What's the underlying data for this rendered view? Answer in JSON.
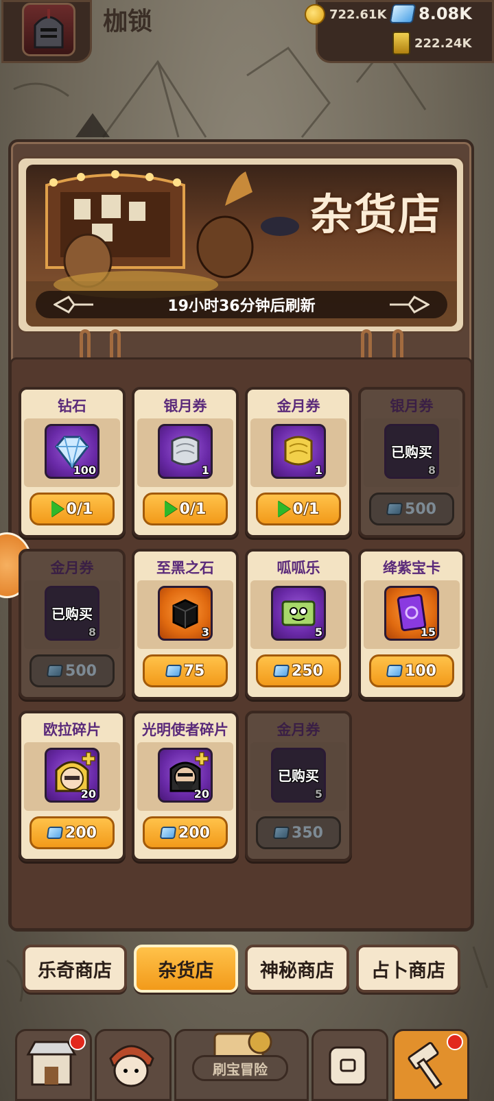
{
  "header": {
    "title": "枷锁",
    "gold": "722.61K",
    "diamonds": "8.08K",
    "potion": "222.24K"
  },
  "banner": {
    "title": "杂货店",
    "refresh": "19小时36分钟后刷新"
  },
  "items": [
    {
      "name": "钻石",
      "qty": "100",
      "price": "0/1",
      "type": "ad",
      "sold": false
    },
    {
      "name": "银月券",
      "qty": "1",
      "price": "0/1",
      "type": "ad",
      "sold": false
    },
    {
      "name": "金月券",
      "qty": "1",
      "price": "0/1",
      "type": "ad",
      "sold": false
    },
    {
      "name": "银月券",
      "qty": "8",
      "price": "500",
      "type": "gem",
      "sold": true,
      "sold_text": "已购买"
    },
    {
      "name": "金月券",
      "qty": "8",
      "price": "500",
      "type": "gem",
      "sold": true,
      "sold_text": "已购买"
    },
    {
      "name": "至黑之石",
      "qty": "3",
      "price": "75",
      "type": "gem",
      "sold": false
    },
    {
      "name": "呱呱乐",
      "qty": "5",
      "price": "250",
      "type": "gem",
      "sold": false
    },
    {
      "name": "绛紫宝卡",
      "qty": "15",
      "price": "100",
      "type": "gem",
      "sold": false
    },
    {
      "name": "欧拉碎片",
      "qty": "20",
      "price": "200",
      "type": "gem",
      "sold": false
    },
    {
      "name": "光明使者碎片",
      "qty": "20",
      "price": "200",
      "type": "gem",
      "sold": false
    },
    {
      "name": "金月券",
      "qty": "5",
      "price": "350",
      "type": "gem",
      "sold": true,
      "sold_text": "已购买"
    }
  ],
  "tabs": [
    "乐奇商店",
    "杂货店",
    "神秘商店",
    "占卜商店"
  ],
  "bottom_nav": {
    "adventure_label": "刷宝冒险"
  },
  "colors": {
    "accent": "#f29a1a",
    "panel": "#5b4336",
    "card": "#f3e3c3",
    "name": "#5a2a7a"
  }
}
